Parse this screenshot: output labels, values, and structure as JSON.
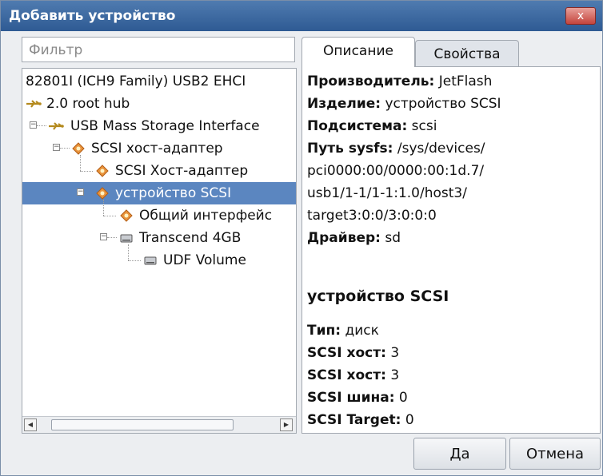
{
  "window": {
    "title": "Добавить устройство",
    "close": "x"
  },
  "filter": {
    "placeholder": "Фильтр",
    "value": ""
  },
  "tree": [
    {
      "label": "82801I (ICH9 Family) USB2 EHCI",
      "icon": "none"
    },
    {
      "label": "2.0 root hub",
      "icon": "usb-icon"
    },
    {
      "label": "USB Mass Storage Interface",
      "icon": "usb-icon"
    },
    {
      "label": "SCSI хост-адаптер",
      "icon": "scsi-icon"
    },
    {
      "label": "SCSI Хост-адаптер",
      "icon": "scsi-icon"
    },
    {
      "label": "устройство SCSI",
      "icon": "scsi-icon",
      "selected": true
    },
    {
      "label": "Общий интерфейс",
      "icon": "scsi-icon"
    },
    {
      "label": "Transcend 4GB",
      "icon": "disk-icon"
    },
    {
      "label": "UDF Volume",
      "icon": "disk-icon"
    }
  ],
  "tabs": {
    "description": "Описание",
    "properties": "Свойства"
  },
  "details": {
    "manufacturer_label": "Производитель:",
    "manufacturer": "JetFlash",
    "product_label": "Изделие:",
    "product": "устройство SCSI",
    "subsystem_label": "Подсистема:",
    "subsystem": "scsi",
    "sysfs_label": "Путь sysfs:",
    "sysfs_1": "/sys/devices/",
    "sysfs_2": "pci0000:00/0000:00:1d.7/",
    "sysfs_3": "usb1/1-1/1-1:1.0/host3/",
    "sysfs_4": "target3:0:0/3:0:0:0",
    "driver_label": "Драйвер:",
    "driver": "sd",
    "section_title": "устройство SCSI",
    "type_label": "Тип:",
    "type": "диск",
    "host1_label": "SCSI хост:",
    "host1": "3",
    "host2_label": "SCSI хост:",
    "host2": "3",
    "bus_label": "SCSI шина:",
    "bus": "0",
    "target_label": "SCSI Target:",
    "target": "0"
  },
  "buttons": {
    "ok": "Да",
    "cancel": "Отмена"
  },
  "colors": {
    "selection": "#5b86c0",
    "titlebar": "#3a67a0"
  }
}
